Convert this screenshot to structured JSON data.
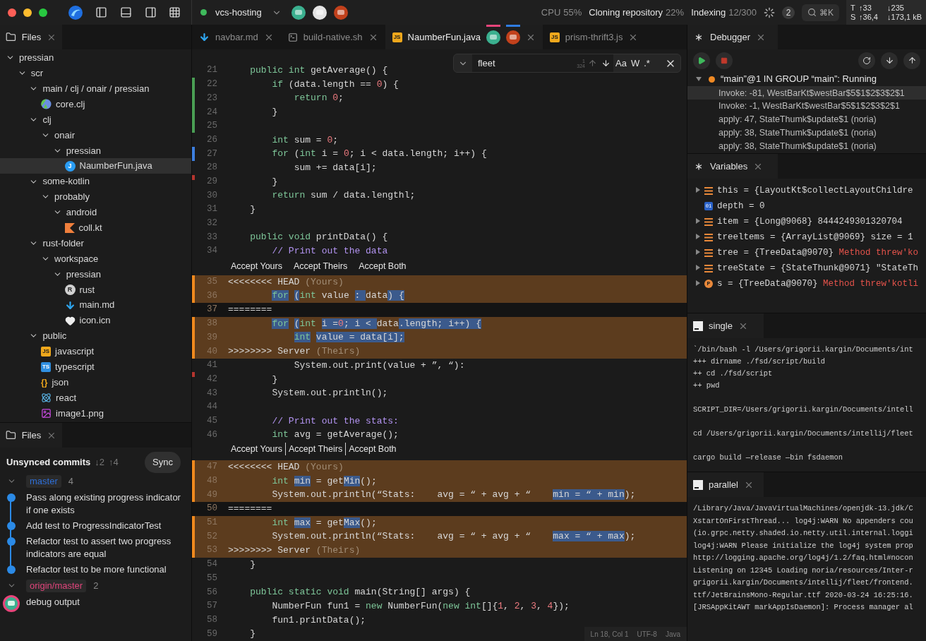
{
  "titlebar": {
    "project": "vcs-hosting",
    "avatars": [
      {
        "color": "#3bb08f"
      },
      {
        "color": "#e4e4e4"
      },
      {
        "color": "#c2411c"
      }
    ],
    "status": [
      {
        "label": "CPU",
        "value": "55%",
        "kind": "metric"
      },
      {
        "label": "Cloning repository",
        "value": "22%",
        "kind": "task"
      },
      {
        "label": "Indexing",
        "value": "12/300",
        "kind": "task"
      }
    ],
    "notifications": "2",
    "search_shortcut": "⌘K",
    "traffic": [
      {
        "label": "T",
        "up": "↑33",
        "down": "↓235"
      },
      {
        "label": "S",
        "up": "↑36,4",
        "down": "↓173,1 kB"
      }
    ]
  },
  "files": {
    "tab": "Files",
    "tree": [
      {
        "name": "pressian",
        "kind": "folder",
        "expanded": true,
        "selected": false,
        "children": [
          {
            "name": "scr",
            "kind": "folder",
            "expanded": true,
            "selected": false,
            "children": [
              {
                "name": "main / clj / onair / pressian",
                "kind": "folder",
                "expanded": true,
                "selected": false,
                "children": [
                  {
                    "name": "core.clj",
                    "kind": "clojure",
                    "selected": false
                  }
                ]
              },
              {
                "name": "clj",
                "kind": "folder",
                "expanded": true,
                "selected": false,
                "children": [
                  {
                    "name": "onair",
                    "kind": "folder",
                    "expanded": true,
                    "selected": false,
                    "children": [
                      {
                        "name": "pressian",
                        "kind": "folder",
                        "expanded": true,
                        "selected": false,
                        "children": [
                          {
                            "name": "NaumberFun.java",
                            "kind": "java",
                            "badge": "J",
                            "selected": true
                          }
                        ]
                      }
                    ]
                  }
                ]
              },
              {
                "name": "some-kotlin",
                "kind": "folder",
                "expanded": true,
                "selected": false,
                "children": [
                  {
                    "name": "probably",
                    "kind": "folder",
                    "expanded": true,
                    "selected": false,
                    "children": [
                      {
                        "name": "android",
                        "kind": "folder",
                        "expanded": true,
                        "selected": false,
                        "children": [
                          {
                            "name": "coll.kt",
                            "kind": "kotlin",
                            "selected": false
                          }
                        ]
                      }
                    ]
                  }
                ]
              },
              {
                "name": "rust-folder",
                "kind": "folder",
                "expanded": true,
                "selected": false,
                "children": [
                  {
                    "name": "workspace",
                    "kind": "folder",
                    "expanded": true,
                    "selected": false,
                    "children": [
                      {
                        "name": "pressian",
                        "kind": "folder",
                        "expanded": true,
                        "selected": false,
                        "children": [
                          {
                            "name": "rust",
                            "kind": "rust",
                            "badge": "R",
                            "selected": false
                          },
                          {
                            "name": "main.md",
                            "kind": "markdown",
                            "selected": false
                          },
                          {
                            "name": "icon.icn",
                            "kind": "heart",
                            "selected": false
                          }
                        ]
                      }
                    ]
                  }
                ]
              },
              {
                "name": "public",
                "kind": "folder",
                "expanded": true,
                "selected": false,
                "children": [
                  {
                    "name": "javascript",
                    "kind": "javascript",
                    "badge": "JS",
                    "selected": false
                  },
                  {
                    "name": "typescript",
                    "kind": "typescript",
                    "badge": "TS",
                    "selected": false
                  },
                  {
                    "name": "json",
                    "kind": "json",
                    "badge": "{}",
                    "selected": false
                  },
                  {
                    "name": "react",
                    "kind": "react",
                    "selected": false
                  },
                  {
                    "name": "image1.png",
                    "kind": "image",
                    "selected": false
                  }
                ]
              }
            ]
          }
        ]
      }
    ]
  },
  "git": {
    "tab": "Files",
    "title": "Unsynced commits",
    "incoming": "↓2",
    "outgoing": "↑4",
    "sync": "Sync",
    "branches": [
      {
        "name": "master",
        "count": "4",
        "color": "#2e6fd8",
        "expanded": true,
        "commits": [
          {
            "message": "Pass along existing progress indicator if one exists",
            "kind": "dot"
          },
          {
            "message": "Add test to ProgressIndicatorTest",
            "kind": "dot"
          },
          {
            "message": "Refactor test to assert two progress indicators are equal",
            "kind": "dot"
          },
          {
            "message": "Refactor test to be more functional",
            "kind": "dot"
          }
        ]
      },
      {
        "name": "origin/master",
        "count": "2",
        "color": "#e0457b",
        "expanded": true,
        "commits": [
          {
            "message": "debug output",
            "kind": "avatar"
          }
        ]
      }
    ]
  },
  "editor": {
    "tabs": [
      {
        "name": "navbar.md",
        "kind": "markdown",
        "selected": false
      },
      {
        "name": "build-native.sh",
        "kind": "terminal",
        "selected": false
      },
      {
        "name": "NaumberFun.java",
        "kind": "javascript",
        "badge": "JS",
        "selected": true,
        "collaborators": [
          {
            "marker": {
              "color": "#e8447a"
            },
            "avatar": {
              "color": "#3bb08f"
            }
          },
          {
            "marker": {
              "color": "#2f7de1"
            },
            "avatar": {
              "color": "#c2411c"
            }
          }
        ]
      },
      {
        "name": "prism-thrift3.js",
        "kind": "javascript",
        "badge": "JS",
        "selected": false
      }
    ],
    "find": {
      "value": "fleet",
      "current": "1",
      "total": "324",
      "options": [
        "Aa",
        "W",
        ".*"
      ]
    },
    "lines": [
      {
        "n": "21",
        "kind": "normal",
        "tokens": [
          {
            "t": "    public int",
            "kind": "kw"
          },
          {
            "t": " getAverage() {"
          }
        ]
      },
      {
        "n": "22",
        "kind": "normal",
        "marker": {
          "kind": "added"
        },
        "tokens": [
          {
            "t": "        if",
            "kind": "kw"
          },
          {
            "t": " (data.length == "
          },
          {
            "t": "0",
            "kind": "num"
          },
          {
            "t": ") {"
          }
        ]
      },
      {
        "n": "23",
        "kind": "normal",
        "marker": {
          "kind": "added"
        },
        "tokens": [
          {
            "t": "            return",
            "kind": "kw"
          },
          {
            "t": " 0",
            "kind": "num"
          },
          {
            "t": ";"
          }
        ]
      },
      {
        "n": "24",
        "kind": "normal",
        "marker": {
          "kind": "added"
        },
        "tokens": [
          {
            "t": "        }"
          }
        ]
      },
      {
        "n": "25",
        "kind": "normal",
        "marker": {
          "kind": "added"
        }
      },
      {
        "n": "26",
        "kind": "normal",
        "tokens": [
          {
            "t": "        int",
            "kind": "kw"
          },
          {
            "t": " sum = "
          },
          {
            "t": "0",
            "kind": "num"
          },
          {
            "t": ";"
          }
        ]
      },
      {
        "n": "27",
        "kind": "normal",
        "marker": {
          "kind": "modified"
        },
        "tokens": [
          {
            "t": "        for",
            "kind": "kw"
          },
          {
            "t": " ("
          },
          {
            "t": "int",
            "kind": "kw"
          },
          {
            "t": " i = "
          },
          {
            "t": "0",
            "kind": "num"
          },
          {
            "t": "; i < data.length; i++) {"
          }
        ]
      },
      {
        "n": "28",
        "kind": "normal",
        "tokens": [
          {
            "t": "            sum += data[i];"
          }
        ]
      },
      {
        "n": "29",
        "kind": "normal",
        "marker": {
          "kind": "error"
        },
        "tokens": [
          {
            "t": "        }"
          }
        ]
      },
      {
        "n": "30",
        "kind": "normal",
        "tokens": [
          {
            "t": "        return",
            "kind": "kw"
          },
          {
            "t": " sum / data.lengthl;"
          }
        ]
      },
      {
        "n": "31",
        "kind": "normal",
        "tokens": [
          {
            "t": "    }"
          }
        ]
      },
      {
        "n": "32",
        "kind": "normal"
      },
      {
        "n": "33",
        "kind": "normal",
        "tokens": [
          {
            "t": "    public void",
            "kind": "kw"
          },
          {
            "t": " printData() {"
          }
        ]
      },
      {
        "n": "34",
        "kind": "normal",
        "tokens": [
          {
            "t": "        // Print out the data",
            "kind": "cmt"
          }
        ]
      },
      {
        "kind": "actions",
        "actions": [
          "Accept Yours",
          "Accept Theirs",
          "Accept Both"
        ]
      },
      {
        "n": "35",
        "kind": "conflict",
        "tokens": [
          {
            "t": "<<<<<<<< HEAD"
          },
          {
            "t": " (Yours)",
            "kind": "dim"
          }
        ]
      },
      {
        "n": "36",
        "kind": "conflict",
        "tokens": [
          {
            "t": "        for",
            "kind": "kw",
            "sel": true
          },
          {
            "t": " (",
            "sel": true
          },
          {
            "t": "int",
            "kind": "kw"
          },
          {
            "t": " value"
          },
          {
            "t": " : ",
            "sel": true
          },
          {
            "t": "data"
          },
          {
            "t": ") {",
            "sel": true
          }
        ]
      },
      {
        "n": "37",
        "kind": "separator",
        "tokens": [
          {
            "t": "========"
          }
        ]
      },
      {
        "n": "38",
        "kind": "conflict",
        "tokens": [
          {
            "t": "        for",
            "kind": "kw",
            "sel": true
          },
          {
            "t": " (",
            "sel": true
          },
          {
            "t": "int",
            "kind": "kw"
          },
          {
            "t": " i =",
            "sel": true
          },
          {
            "t": "0",
            "kind": "num",
            "sel": true
          },
          {
            "t": "; i < ",
            "sel": true
          },
          {
            "t": "data"
          },
          {
            "t": ".length; i++) {",
            "sel": true
          }
        ]
      },
      {
        "n": "39",
        "kind": "conflict",
        "tokens": [
          {
            "t": "            int",
            "kind": "kw",
            "sel": true
          },
          {
            "t": " value = data[i];",
            "sel": true
          }
        ]
      },
      {
        "n": "40",
        "kind": "conflict",
        "tokens": [
          {
            "t": ">>>>>>>> Server"
          },
          {
            "t": " (Theirs)",
            "kind": "dim"
          }
        ]
      },
      {
        "n": "41",
        "kind": "normal",
        "tokens": [
          {
            "t": "            System.out.print(value + ”, “):"
          }
        ]
      },
      {
        "n": "42",
        "kind": "normal",
        "marker": {
          "kind": "error"
        },
        "tokens": [
          {
            "t": "        }"
          }
        ]
      },
      {
        "n": "43",
        "kind": "normal",
        "tokens": [
          {
            "t": "        System.out.println();"
          }
        ]
      },
      {
        "n": "44",
        "kind": "normal"
      },
      {
        "n": "45",
        "kind": "normal",
        "tokens": [
          {
            "t": "        // Print out the stats:",
            "kind": "cmt"
          }
        ]
      },
      {
        "n": "46",
        "kind": "normal",
        "tokens": [
          {
            "t": "        int",
            "kind": "kw"
          },
          {
            "t": " avg = getAverage();"
          }
        ]
      },
      {
        "kind": "divided_actions",
        "actions": [
          "Accept Yours",
          "Accept Theirs",
          "Accept Both"
        ]
      },
      {
        "n": "47",
        "kind": "conflict",
        "tokens": [
          {
            "t": "<<<<<<<< HEAD"
          },
          {
            "t": " (Yours)",
            "kind": "dim"
          }
        ]
      },
      {
        "n": "48",
        "kind": "conflict",
        "tokens": [
          {
            "t": "        int ",
            "kind": "kw"
          },
          {
            "t": "min",
            "sel": true
          },
          {
            "t": " = get"
          },
          {
            "t": "Min",
            "sel": true
          },
          {
            "t": "();"
          }
        ]
      },
      {
        "n": "49",
        "kind": "conflict",
        "tokens": [
          {
            "t": "        System.out.println(“Stats:    avg = “ + avg + “    "
          },
          {
            "t": "min = “ + min",
            "sel": true
          },
          {
            "t": ");"
          }
        ]
      },
      {
        "n": "50",
        "kind": "separator",
        "tokens": [
          {
            "t": "========"
          }
        ]
      },
      {
        "n": "51",
        "kind": "conflict",
        "tokens": [
          {
            "t": "        int ",
            "kind": "kw"
          },
          {
            "t": "max",
            "sel": true
          },
          {
            "t": " = get"
          },
          {
            "t": "Max",
            "sel": true
          },
          {
            "t": "();"
          }
        ]
      },
      {
        "n": "52",
        "kind": "conflict",
        "tokens": [
          {
            "t": "        System.out.println(“Stats:    avg = “ + avg + “    "
          },
          {
            "t": "max = “ + max",
            "sel": true
          },
          {
            "t": ");"
          }
        ]
      },
      {
        "n": "53",
        "kind": "conflict",
        "tokens": [
          {
            "t": ">>>>>>>> Server"
          },
          {
            "t": " (Theirs)",
            "kind": "dim"
          }
        ]
      },
      {
        "n": "54",
        "kind": "normal",
        "tokens": [
          {
            "t": "    }"
          }
        ]
      },
      {
        "n": "55",
        "kind": "normal"
      },
      {
        "n": "56",
        "kind": "normal",
        "tokens": [
          {
            "t": "    public static void",
            "kind": "kw"
          },
          {
            "t": " main(String[] args) {"
          }
        ]
      },
      {
        "n": "57",
        "kind": "normal",
        "tokens": [
          {
            "t": "        NumberFun fun1 = "
          },
          {
            "t": "new",
            "kind": "kw"
          },
          {
            "t": " NumberFun("
          },
          {
            "t": "new int",
            "kind": "kw"
          },
          {
            "t": "[]{"
          },
          {
            "t": "1",
            "kind": "num"
          },
          {
            "t": ", "
          },
          {
            "t": "2",
            "kind": "num"
          },
          {
            "t": ", "
          },
          {
            "t": "3",
            "kind": "num"
          },
          {
            "t": ", "
          },
          {
            "t": "4",
            "kind": "num"
          },
          {
            "t": "});"
          }
        ]
      },
      {
        "n": "58",
        "kind": "normal",
        "tokens": [
          {
            "t": "        fun1.printData();"
          }
        ]
      },
      {
        "n": "59",
        "kind": "normal",
        "tokens": [
          {
            "t": "    }"
          }
        ]
      }
    ],
    "status": [
      "Ln 18, Col 1",
      "UTF-8",
      "Java"
    ]
  },
  "debugger": {
    "tab": "Debugger",
    "thread": {
      "name": "“main”@1 IN GROUP “main”: Running",
      "expanded": true
    },
    "frames": [
      {
        "text": "Invoke: -81, WestBarKt$westBar$5$1$2$3$2$1",
        "selected": true
      },
      {
        "text": "Invoke: -1, WestBarKt$westBar$5$1$2$3$2$1",
        "selected": false
      },
      {
        "text": "apply: 47, StateThumk$update$1 (noria)",
        "selected": false
      },
      {
        "text": "apply: 38, StateThumk$update$1 (noria)",
        "selected": false
      },
      {
        "text": "apply: 38, StateThumk$update$1 (noria)",
        "selected": false
      }
    ]
  },
  "variables": {
    "tab": "Variables",
    "items": [
      {
        "kind": "object",
        "text": "this = {LayoutKt$collectLayoutChildre"
      },
      {
        "kind": "primitive",
        "badge": "01",
        "text": "depth = 0"
      },
      {
        "kind": "object",
        "text": "item = {Long@9068} 8444249301320704"
      },
      {
        "kind": "object",
        "text": "treeltems = {ArrayList@9069} size = 1"
      },
      {
        "kind": "object",
        "text": "tree = {TreeData@9070} ",
        "error": "Method threw'ko"
      },
      {
        "kind": "object",
        "text": "treeState = {StateThunk@9071} \"StateTh"
      },
      {
        "kind": "property",
        "badge": "P",
        "text": "s = {TreeData@9070} ",
        "error": "Method threw'kotli"
      }
    ]
  },
  "terminals": [
    {
      "tab": "single",
      "blocks": [
        [
          "`/bin/bash -l /Users/grigorii.kargin/Documents/int",
          "+++ dirname ./fsd/script/build",
          "++ cd ./fsd/script",
          "++ pwd"
        ],
        [
          "SCRIPT_DIR=/Users/grigorii.kargin/Documents/intell"
        ],
        [
          "cd /Users/grigorii.kargin/Documents/intellij/fleet"
        ],
        [
          "cargo build —release —bin fsdaemon"
        ]
      ]
    },
    {
      "tab": "parallel",
      "blocks": [
        [
          "/Library/Java/JavaVirtualMachines/openjdk-13.jdk/C",
          "XstartOnFirstThread... log4j:WARN No appenders cou",
          "(io.grpc.netty.shaded.io.netty.util.internal.loggi",
          "log4j:WARN Please initialize the log4j system prop",
          "http://logging.apache.org/log4j/1.2/faq.html#nocon",
          "Listening on 12345 Loading noria/resources/Inter-r",
          "grigorii.kargin/Documents/intellij/fleet/frontend.",
          "ttf/JetBrainsMono-Regular.ttf 2020-03-24 16:25:16.",
          "[JRSAppKitAWT markAppIsDaemon]: Process manager al"
        ]
      ]
    }
  ]
}
